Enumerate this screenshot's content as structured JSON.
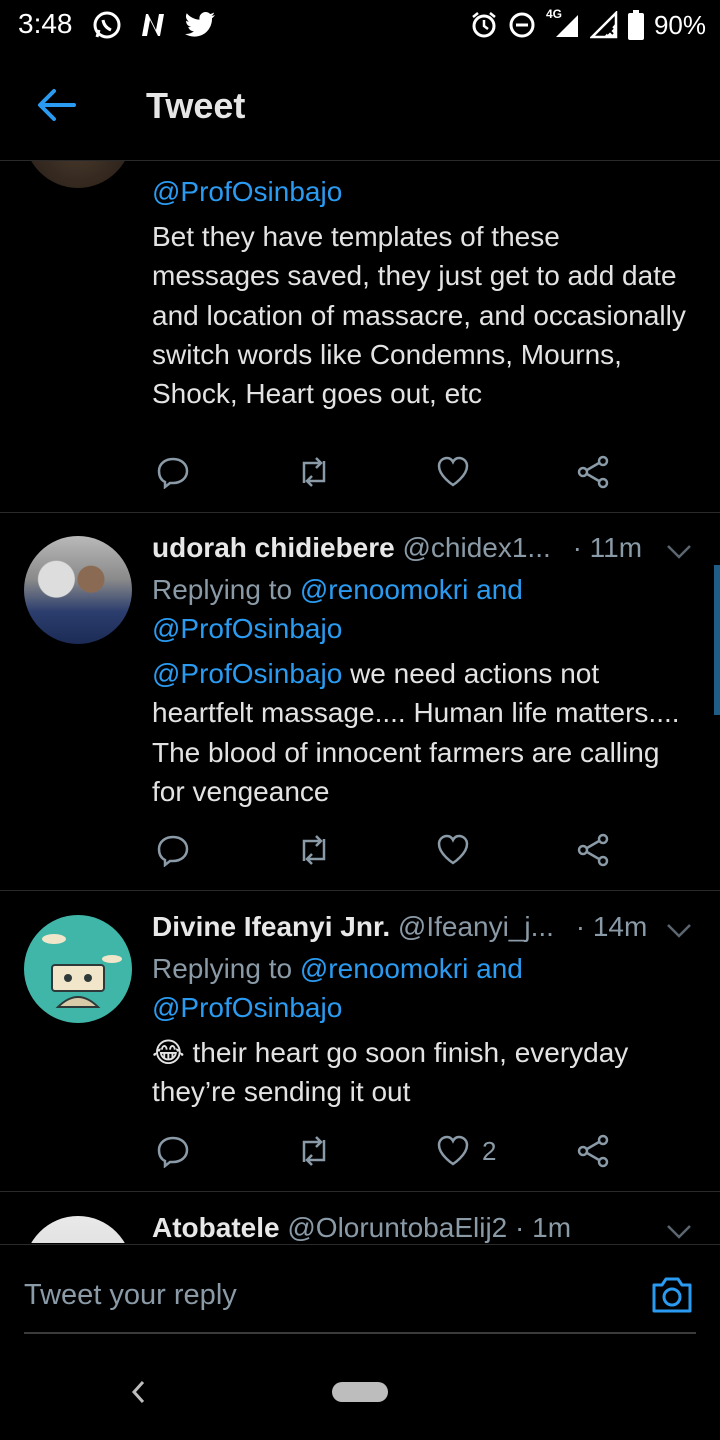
{
  "status_bar": {
    "time": "3:48",
    "left_icons": [
      "whatsapp-icon",
      "n-app-icon",
      "twitter-icon"
    ],
    "right_icons": [
      "alarm-icon",
      "dnd-icon",
      "signal-4g-icon",
      "signal-icon",
      "battery-icon"
    ],
    "network": "4G",
    "battery": "90%"
  },
  "header": {
    "title": "Tweet",
    "accent": "#1DA1F2"
  },
  "tweets": [
    {
      "reply_to_tail": "@ProfOsinbajo",
      "text": "Bet they have templates of these messages saved, they just get to add date and location of massacre, and occasionally switch words like Condemns, Mourns, Shock, Heart goes out, etc",
      "likes": ""
    },
    {
      "name": "udorah chidiebere",
      "handle": "@chidex1...",
      "time": "· 11m",
      "replying_prefix": "Replying to",
      "replying_links": "@renoomokri and",
      "replying_links2": "@ProfOsinbajo",
      "mention": "@ProfOsinbajo",
      "text": " we need actions not heartfelt massage.... Human life matters.... The blood of innocent farmers are calling for vengeance",
      "likes": ""
    },
    {
      "name": "Divine Ifeanyi Jnr.",
      "handle": "@Ifeanyi_j...",
      "time": "· 14m",
      "replying_prefix": "Replying to",
      "replying_links": "@renoomokri and",
      "replying_links2": "@ProfOsinbajo",
      "emoji": "😂",
      "text": " their heart go soon finish, everyday they’re sending it out",
      "likes": "2"
    },
    {
      "name": "Atobatele",
      "handle": "@OloruntobaElij2",
      "time": "· 1m"
    }
  ],
  "reply_box": {
    "placeholder": "Tweet your reply"
  }
}
